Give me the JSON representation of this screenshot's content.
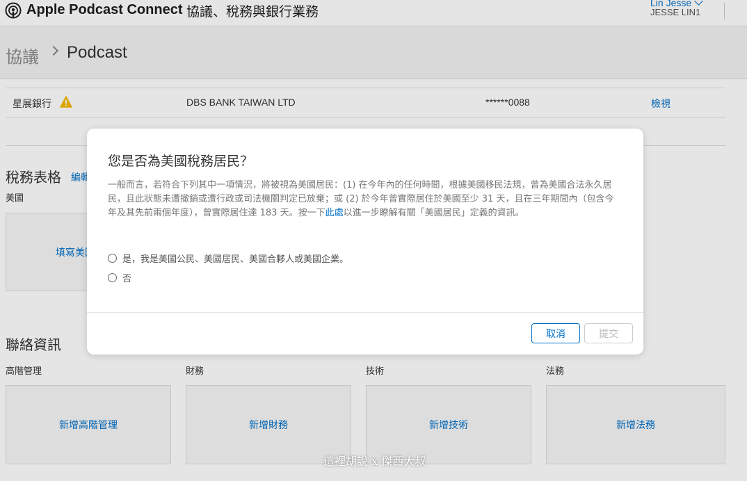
{
  "header": {
    "app_title": "Apple Podcast Connect",
    "section": "協議、稅務與銀行業務",
    "user_name": "Lin Jesse",
    "user_id": "JESSE LIN1"
  },
  "breadcrumb": {
    "root": "協議",
    "current": "Podcast"
  },
  "bank_row": {
    "bank_name": "星展銀行",
    "institution": "DBS BANK TAIWAN LTD",
    "account": "******0088",
    "action": "檢視",
    "warning_icon": "warning-triangle-icon",
    "warning_color": "#f5b800"
  },
  "tax": {
    "title": "稅務表格",
    "edit": "編輯",
    "country": "美國",
    "card_label": "填寫美國"
  },
  "contacts": {
    "title": "聯絡資訊",
    "columns": [
      {
        "label": "高階管理",
        "card": "新增高階管理"
      },
      {
        "label": "財務",
        "card": "新增財務"
      },
      {
        "label": "技術",
        "card": "新增技術"
      },
      {
        "label": "法務",
        "card": "新增法務"
      }
    ]
  },
  "modal": {
    "title": "您是否為美國稅務居民？",
    "body_before_link": "一般而言，若符合下列其中一項情況，將被視為美國居民：(1) 在今年內的任何時間，根據美國移民法規，曾為美國合法永久居民，且此狀態未遭撤銷或遭行政或司法機關判定已放棄；或 (2) 於今年曾實際居住於美國至少 31 天，且在三年期間內（包含今年及其先前兩個年度），曾實際居住達 183 天。按一下",
    "link": "此處",
    "body_after_link": "以進一步瞭解有關「美國居民」定義的資訊。",
    "option_yes": "是，我是美國公民、美國居民、美國合夥人或美國企業。",
    "option_no": "否",
    "cancel": "取消",
    "submit": "提交"
  },
  "watermark": "這裡胡說 x 傑西大叔",
  "colors": {
    "accent": "#0070c9"
  }
}
